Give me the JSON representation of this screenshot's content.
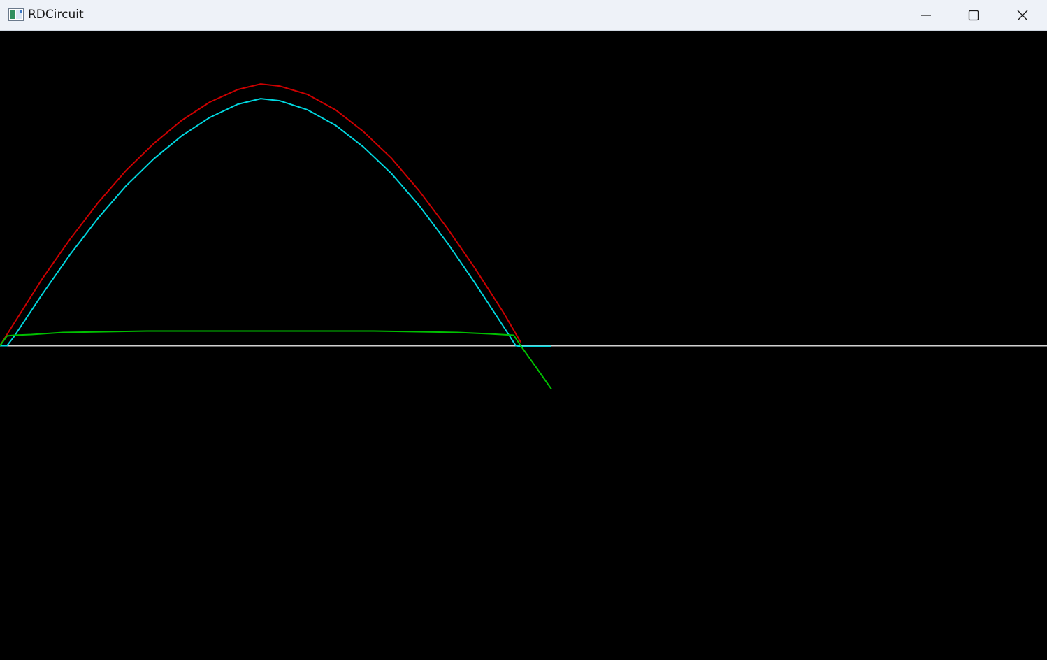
{
  "window": {
    "title": "RDCircuit",
    "app_icon": "window-app-icon",
    "controls": [
      "minimize-icon",
      "maximize-icon",
      "close-icon"
    ]
  },
  "colors": {
    "titlebar_bg": "#eef2f8",
    "canvas_bg": "#000000",
    "axis": "#d0d0d0",
    "input_voltage": "#cc0000",
    "output_voltage": "#00d8e0",
    "diode_voltage": "#00c000"
  },
  "chart_data": {
    "type": "line",
    "grid": false,
    "legend": "none",
    "xlim": [
      0,
      1498
    ],
    "ylim": [
      -445,
      449
    ],
    "series": [
      {
        "color": "#cc0000",
        "x": [
          0,
          20,
          60,
          100,
          140,
          180,
          220,
          260,
          300,
          340,
          373,
          400,
          440,
          480,
          520,
          560,
          600,
          640,
          680,
          720,
          745
        ],
        "y": [
          0,
          32,
          95,
          152,
          204,
          250,
          289,
          322,
          348,
          366,
          374,
          371,
          359,
          337,
          306,
          268,
          221,
          168,
          110,
          48,
          5
        ]
      },
      {
        "color": "#00d8e0",
        "x": [
          0,
          10,
          20,
          60,
          100,
          140,
          180,
          220,
          260,
          300,
          340,
          373,
          400,
          440,
          480,
          520,
          560,
          600,
          640,
          680,
          720,
          738,
          745,
          789
        ],
        "y": [
          0,
          0,
          13,
          73,
          130,
          182,
          228,
          267,
          300,
          326,
          345,
          353,
          350,
          337,
          315,
          284,
          246,
          200,
          147,
          89,
          28,
          0,
          -1,
          -1
        ]
      },
      {
        "color": "#00c000",
        "x": [
          0,
          10,
          20,
          45,
          90,
          210,
          380,
          535,
          655,
          700,
          735,
          745,
          765,
          789
        ],
        "y": [
          0,
          14,
          15,
          16,
          19,
          21,
          21,
          21,
          19,
          17,
          15,
          0,
          -28,
          -62
        ]
      },
      {
        "color": "#d0d0d0",
        "x": [
          0,
          1498
        ],
        "y": [
          0,
          0
        ]
      }
    ]
  }
}
